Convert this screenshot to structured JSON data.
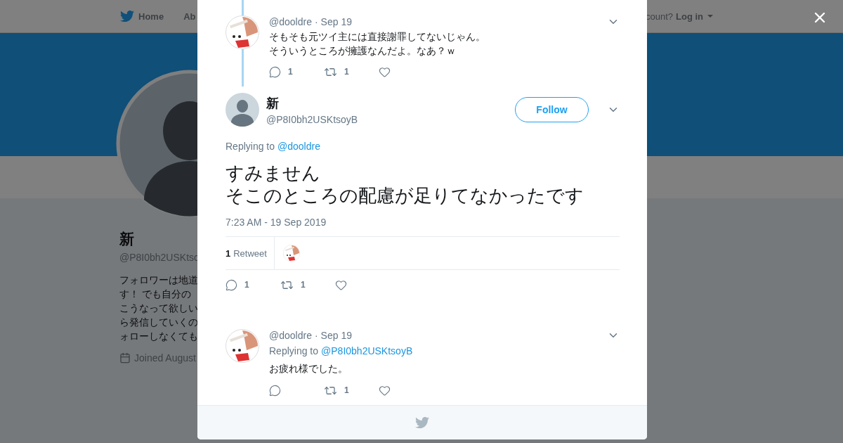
{
  "nav": {
    "home": "Home",
    "about": "Ab",
    "login_prompt": "count?",
    "login": "Log in"
  },
  "profile": {
    "name": "新",
    "handle": "@P8I0bh2USKtso",
    "bio_lines": [
      "フォロワーは地道",
      "す！ でも自分の",
      "こうなって欲しい",
      "ら発信していくの",
      "ォローしなくても"
    ],
    "joined": "Joined August"
  },
  "tweets": [
    {
      "kind": "reply",
      "thread": true,
      "handle": "@dooldre",
      "separator": "·",
      "date": "Sep 19",
      "text_lines": [
        "そもそも元ツイ主には直接謝罪してないじゃん。",
        "そういうところが擁護なんだよ。なあ？ｗ"
      ],
      "actions": [
        {
          "kind": "reply",
          "count": "1"
        },
        {
          "kind": "retweet",
          "count": "1"
        },
        {
          "kind": "like"
        }
      ]
    },
    {
      "kind": "main",
      "name": "新",
      "handle": "@P8I0bh2USKtsoyB",
      "follow": "Follow",
      "replying_prefix": "Replying to",
      "replying_to": "@dooldre",
      "text_lines": [
        "すみません",
        "そこのところの配慮が足りてなかったです"
      ],
      "timestamp": "7:23 AM - 19 Sep 2019",
      "retweet_count": "1",
      "retweet_label": "Retweet",
      "actions": [
        {
          "kind": "reply",
          "count": "1"
        },
        {
          "kind": "retweet",
          "count": "1"
        },
        {
          "kind": "like"
        }
      ]
    },
    {
      "kind": "reply",
      "thread": false,
      "handle": "@dooldre",
      "separator": "·",
      "date": "Sep 19",
      "replying_prefix": "Replying to",
      "replying_to": "@P8I0bh2USKtsoyB",
      "text_lines": [
        "お疲れ様でした。"
      ],
      "actions": [
        {
          "kind": "reply"
        },
        {
          "kind": "retweet",
          "count": "1"
        },
        {
          "kind": "like"
        }
      ]
    }
  ]
}
